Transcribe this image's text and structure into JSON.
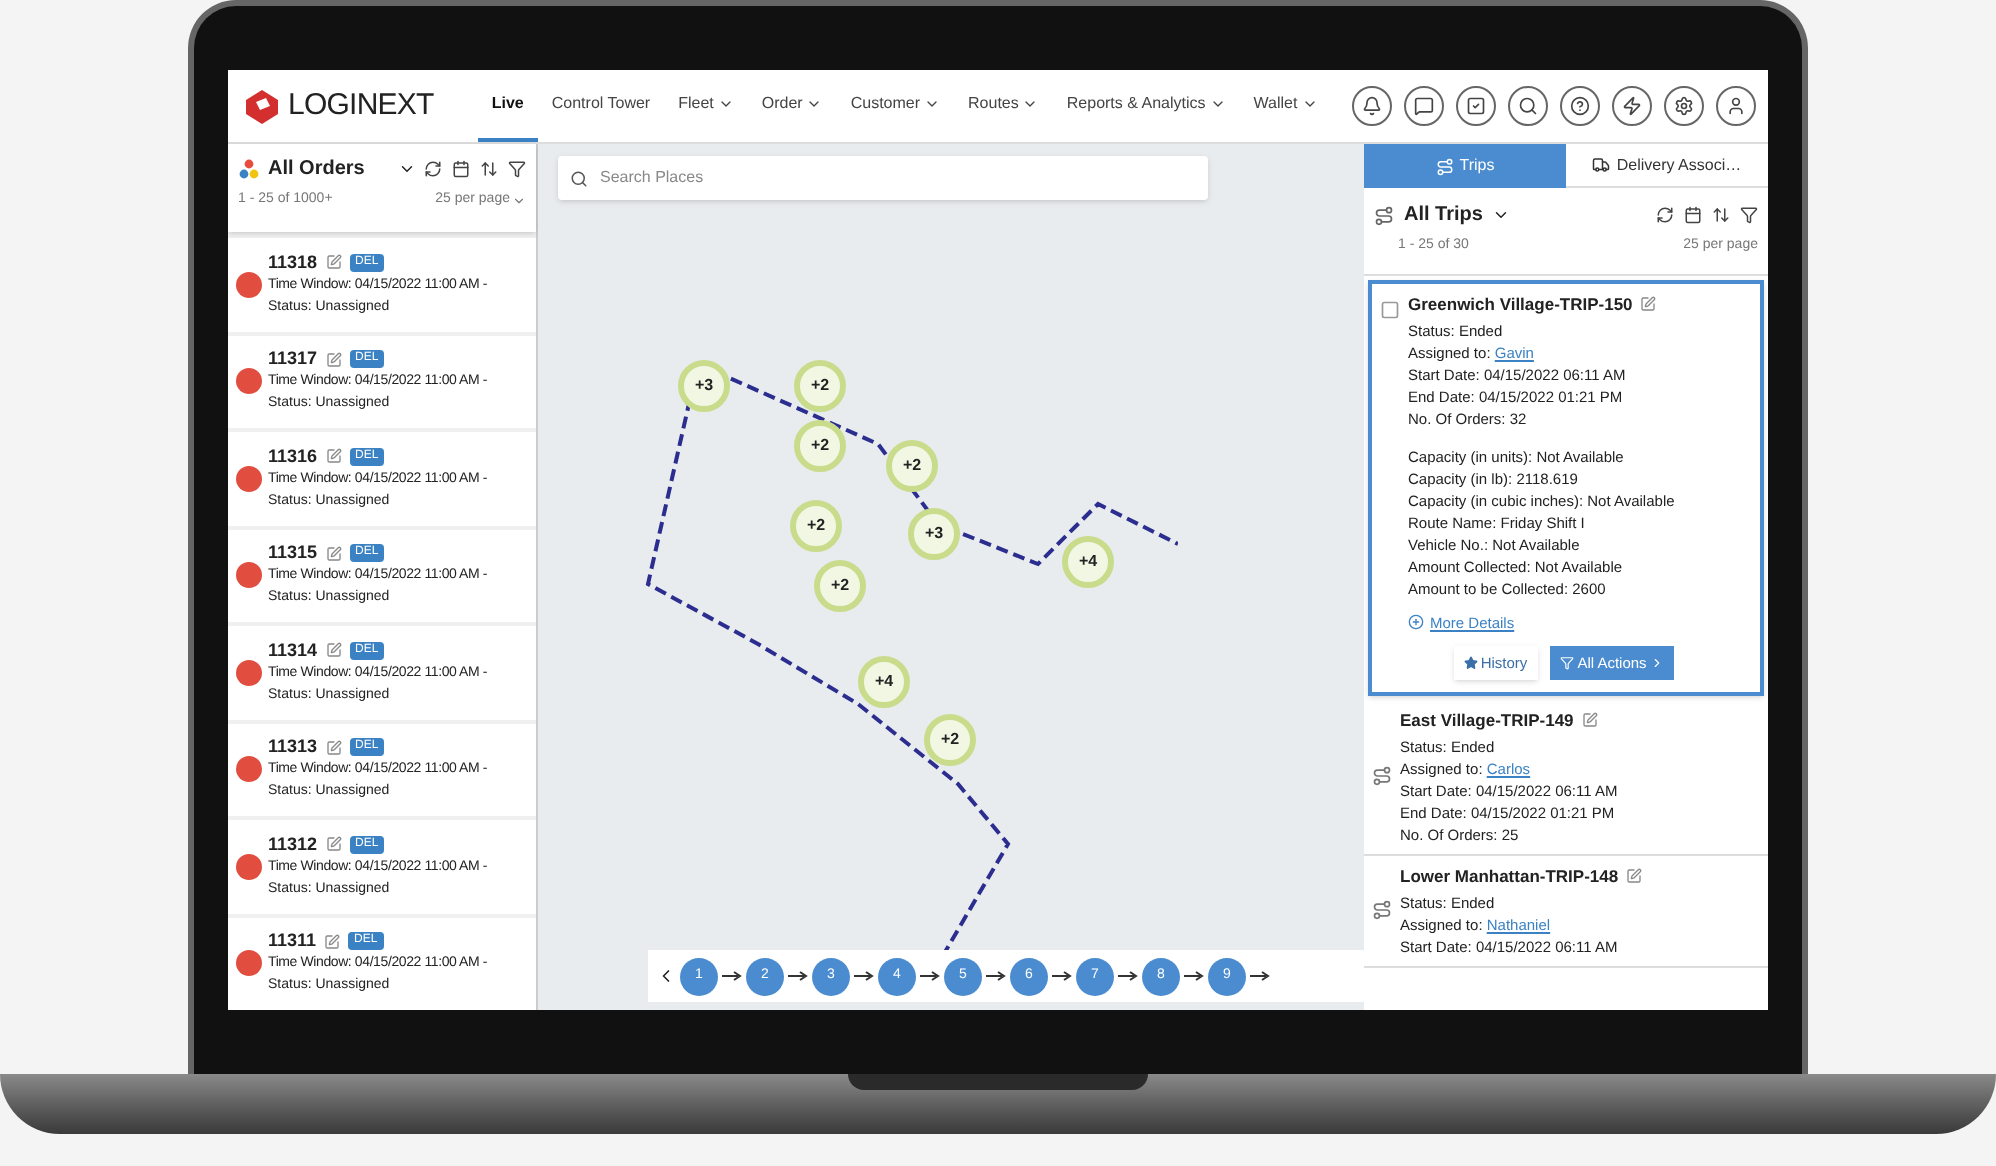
{
  "brand": "LOGINEXT",
  "nav": [
    {
      "label": "Live",
      "selected": true,
      "dropdown": false
    },
    {
      "label": "Control Tower",
      "selected": false,
      "dropdown": false
    },
    {
      "label": "Fleet",
      "selected": false,
      "dropdown": true
    },
    {
      "label": "Order",
      "selected": false,
      "dropdown": true
    },
    {
      "label": "Customer",
      "selected": false,
      "dropdown": true
    },
    {
      "label": "Routes",
      "selected": false,
      "dropdown": true
    },
    {
      "label": "Reports & Analytics",
      "selected": false,
      "dropdown": true
    },
    {
      "label": "Wallet",
      "selected": false,
      "dropdown": true
    }
  ],
  "orders_panel": {
    "title": "All Orders",
    "pagination": "1 - 25 of 1000+",
    "per_page": "25 per page",
    "orders": [
      {
        "id": "11318",
        "tag": "DEL",
        "time_window": "Time Window: 04/15/2022 11:00 AM -",
        "status": "Status: Unassigned"
      },
      {
        "id": "11317",
        "tag": "DEL",
        "time_window": "Time Window: 04/15/2022 11:00 AM -",
        "status": "Status: Unassigned"
      },
      {
        "id": "11316",
        "tag": "DEL",
        "time_window": "Time Window: 04/15/2022 11:00 AM -",
        "status": "Status: Unassigned"
      },
      {
        "id": "11315",
        "tag": "DEL",
        "time_window": "Time Window: 04/15/2022 11:00 AM -",
        "status": "Status: Unassigned"
      },
      {
        "id": "11314",
        "tag": "DEL",
        "time_window": "Time Window: 04/15/2022 11:00 AM -",
        "status": "Status: Unassigned"
      },
      {
        "id": "11313",
        "tag": "DEL",
        "time_window": "Time Window: 04/15/2022 11:00 AM -",
        "status": "Status: Unassigned"
      },
      {
        "id": "11312",
        "tag": "DEL",
        "time_window": "Time Window: 04/15/2022 11:00 AM -",
        "status": "Status: Unassigned"
      },
      {
        "id": "11311",
        "tag": "DEL",
        "time_window": "Time Window: 04/15/2022 11:00 AM -",
        "status": "Status: Unassigned"
      }
    ]
  },
  "map": {
    "search": {
      "placeholder": "Search Places"
    },
    "clusters": [
      {
        "label": "+3"
      },
      {
        "label": "+2"
      },
      {
        "label": "+2"
      },
      {
        "label": "+2"
      },
      {
        "label": "+2"
      },
      {
        "label": "+3"
      },
      {
        "label": "+2"
      },
      {
        "label": "+4"
      },
      {
        "label": "+4"
      },
      {
        "label": "+2"
      }
    ],
    "stops": [
      "1",
      "2",
      "3",
      "4",
      "5",
      "6",
      "7",
      "8",
      "9"
    ]
  },
  "trips_panel": {
    "tabs": [
      {
        "label": "Trips",
        "selected": true
      },
      {
        "label": "Delivery Associ…",
        "selected": false
      }
    ],
    "title": "All Trips",
    "pagination": "1 - 25 of 30",
    "per_page": "25 per page",
    "trips": [
      {
        "name": "Greenwich Village-TRIP-150",
        "selected": true,
        "fields": [
          {
            "label": "Status:",
            "value": "Ended",
            "kind": "text"
          },
          {
            "label": "Assigned to:",
            "value": "Gavin",
            "kind": "link"
          },
          {
            "label": "Start Date:",
            "value": "04/15/2022 06:11 AM",
            "kind": "text"
          },
          {
            "label": "End Date:",
            "value": "04/15/2022 01:21 PM",
            "kind": "text"
          },
          {
            "label": "No. Of Orders:",
            "value": "32",
            "kind": "text"
          }
        ],
        "details": [
          {
            "label": "Capacity (in units):",
            "value": "Not Available"
          },
          {
            "label": "Capacity (in lb):",
            "value": "2118.619"
          },
          {
            "label": "Capacity (in cubic inches):",
            "value": "Not Available"
          },
          {
            "label": "Route Name:",
            "value": "Friday Shift I"
          },
          {
            "label": "Vehicle No.:",
            "value": "Not Available"
          },
          {
            "label": "Amount Collected:",
            "value": "Not Available"
          },
          {
            "label": "Amount to be Collected:",
            "value": "2600"
          }
        ],
        "more_details": "More Details",
        "buttons": [
          "History",
          "All Actions"
        ]
      },
      {
        "name": "East Village-TRIP-149",
        "selected": false,
        "fields": [
          {
            "label": "Status:",
            "value": "Ended",
            "kind": "text"
          },
          {
            "label": "Assigned to:",
            "value": "Carlos",
            "kind": "link"
          },
          {
            "label": "Start Date:",
            "value": "04/15/2022 06:11 AM",
            "kind": "text"
          },
          {
            "label": "End Date:",
            "value": "04/15/2022 01:21 PM",
            "kind": "text"
          },
          {
            "label": "No. Of Orders:",
            "value": "25",
            "kind": "text"
          }
        ]
      },
      {
        "name": "Lower Manhattan-TRIP-148",
        "selected": false,
        "fields": [
          {
            "label": "Status:",
            "value": "Ended",
            "kind": "text"
          },
          {
            "label": "Assigned to:",
            "value": "Nathaniel",
            "kind": "link"
          },
          {
            "label": "Start Date:",
            "value": "04/15/2022 06:11 AM",
            "kind": "text"
          }
        ]
      }
    ]
  }
}
